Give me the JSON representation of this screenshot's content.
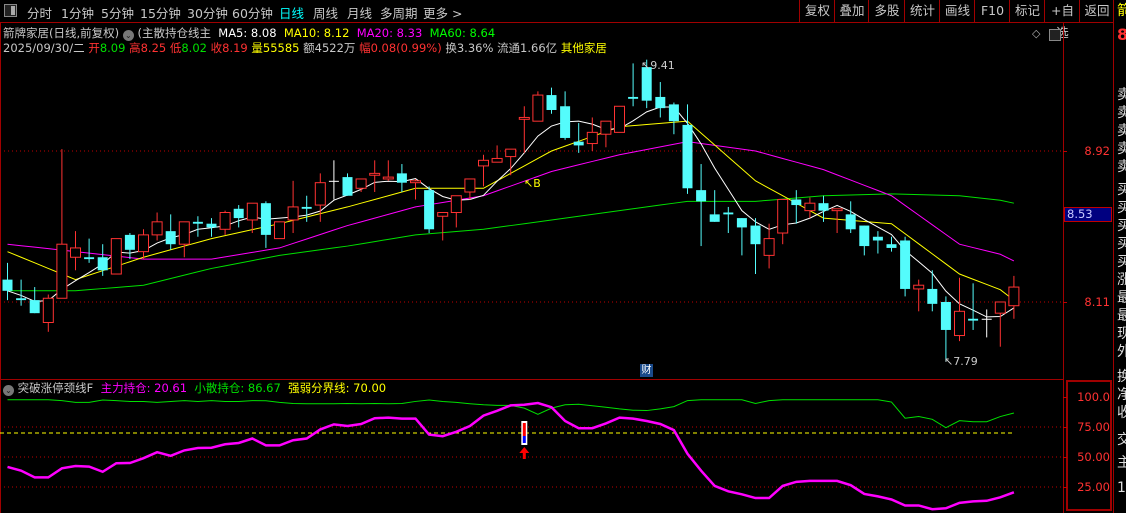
{
  "toolbar": {
    "periods": [
      "分时",
      "1分钟",
      "5分钟",
      "15分钟",
      "30分钟",
      "60分钟",
      "日线",
      "周线",
      "月线",
      "多周期",
      "更多 >"
    ],
    "active_period": "日线",
    "right_buttons": [
      "复权",
      "叠加",
      "多股",
      "统计",
      "画线",
      "F10",
      "标记",
      "+自选",
      "返回"
    ]
  },
  "info": {
    "title": "箭牌家居(日线,前复权)",
    "indicator_name": "(主散持仓线主",
    "ma5": "MA5: 8.08",
    "ma10": "MA10: 8.12",
    "ma20": "MA20: 8.33",
    "ma60": "MA60: 8.64",
    "date": "2025/09/30/二",
    "open_label": "开",
    "open": "8.09",
    "high_label": "高",
    "high": "8.25",
    "low_label": "低",
    "low": "8.02",
    "close_label": "收",
    "close": "8.19",
    "vol_label": "量",
    "vol": "55585",
    "amount": "额4522万",
    "change_label": "幅",
    "change": "0.08(0.99%)",
    "turnover": "换3.36%",
    "float": "流通1.66亿",
    "sector": "其他家居"
  },
  "colors": {
    "up": "#ff3232",
    "down": "#54fcfc",
    "ma5": "#ffffff",
    "ma10": "#ffff00",
    "ma20": "#ff00ff",
    "ma60": "#00e000",
    "grid": "#c00000",
    "main_force": "#ff00ff",
    "retail": "#00e000",
    "threshold": "#ffff00"
  },
  "price_axis": {
    "labels": [
      "8.92",
      "8.11"
    ],
    "current": "8.53"
  },
  "annotations": {
    "high": "9.41",
    "low": "7.79",
    "buy_marker": "B",
    "finance_badge": "财"
  },
  "indicator": {
    "name": "突破涨停颈线F",
    "main_force": "主力持仓: 20.61",
    "retail": "小散持仓: 86.67",
    "threshold": "强弱分界线: 70.00",
    "axis_labels": [
      "100.0",
      "75.00",
      "50.00",
      "25.00"
    ]
  },
  "right_strip": {
    "top": "箭",
    "price": "8",
    "chars": [
      "卖",
      "卖",
      "卖",
      "卖",
      "卖",
      "买",
      "买",
      "买",
      "买",
      "买",
      "涨",
      "最",
      "最",
      "现",
      "外",
      "换",
      "净",
      "收",
      "交",
      "主",
      "1"
    ]
  },
  "chart_data": [
    {
      "type": "candlestick",
      "ohlc_fields": [
        "open",
        "high",
        "low",
        "close"
      ],
      "ylim": [
        7.7,
        9.45
      ],
      "grid_lines": [
        8.92,
        8.11
      ],
      "candles": [
        [
          8.23,
          8.32,
          8.12,
          8.17
        ],
        [
          8.13,
          8.23,
          8.09,
          8.12
        ],
        [
          8.12,
          8.19,
          8.05,
          8.05
        ],
        [
          8.0,
          8.15,
          7.95,
          8.13
        ],
        [
          8.13,
          8.93,
          8.13,
          8.42
        ],
        [
          8.35,
          8.49,
          8.28,
          8.4
        ],
        [
          8.35,
          8.45,
          8.32,
          8.34
        ],
        [
          8.35,
          8.42,
          8.25,
          8.28
        ],
        [
          8.26,
          8.45,
          8.26,
          8.45
        ],
        [
          8.47,
          8.48,
          8.34,
          8.39
        ],
        [
          8.38,
          8.5,
          8.34,
          8.47
        ],
        [
          8.47,
          8.59,
          8.44,
          8.54
        ],
        [
          8.49,
          8.58,
          8.39,
          8.42
        ],
        [
          8.42,
          8.54,
          8.35,
          8.54
        ],
        [
          8.54,
          8.57,
          8.46,
          8.53
        ],
        [
          8.53,
          8.56,
          8.46,
          8.51
        ],
        [
          8.5,
          8.6,
          8.47,
          8.59
        ],
        [
          8.61,
          8.63,
          8.51,
          8.56
        ],
        [
          8.55,
          8.64,
          8.48,
          8.64
        ],
        [
          8.64,
          8.65,
          8.4,
          8.47
        ],
        [
          8.45,
          8.54,
          8.45,
          8.54
        ],
        [
          8.55,
          8.76,
          8.48,
          8.62
        ],
        [
          8.62,
          8.68,
          8.54,
          8.61
        ],
        [
          8.63,
          8.8,
          8.54,
          8.75
        ],
        [
          8.76,
          8.87,
          8.66,
          8.76
        ],
        [
          8.78,
          8.8,
          8.68,
          8.68
        ],
        [
          8.72,
          8.77,
          8.7,
          8.77
        ],
        [
          8.79,
          8.87,
          8.7,
          8.8
        ],
        [
          8.77,
          8.87,
          8.76,
          8.78
        ],
        [
          8.8,
          8.85,
          8.7,
          8.75
        ],
        [
          8.75,
          8.77,
          8.66,
          8.76
        ],
        [
          8.71,
          8.73,
          8.48,
          8.5
        ],
        [
          8.57,
          8.59,
          8.44,
          8.59
        ],
        [
          8.59,
          8.68,
          8.51,
          8.68
        ],
        [
          8.7,
          8.77,
          8.66,
          8.77
        ],
        [
          8.84,
          8.9,
          8.73,
          8.87
        ],
        [
          8.86,
          8.95,
          8.86,
          8.88
        ],
        [
          8.89,
          8.93,
          8.79,
          8.93
        ],
        [
          9.09,
          9.16,
          8.91,
          9.1
        ],
        [
          9.08,
          9.24,
          9.08,
          9.22
        ],
        [
          9.22,
          9.26,
          9.12,
          9.14
        ],
        [
          9.16,
          9.24,
          8.98,
          8.99
        ],
        [
          8.97,
          9.07,
          8.91,
          8.95
        ],
        [
          8.96,
          9.1,
          8.92,
          9.02
        ],
        [
          9.01,
          9.08,
          8.94,
          9.08
        ],
        [
          9.02,
          9.16,
          9.02,
          9.16
        ],
        [
          9.21,
          9.39,
          9.16,
          9.2
        ],
        [
          9.37,
          9.41,
          9.15,
          9.19
        ],
        [
          9.21,
          9.29,
          9.1,
          9.15
        ],
        [
          9.17,
          9.18,
          9.01,
          9.08
        ],
        [
          9.06,
          9.17,
          8.69,
          8.72
        ],
        [
          8.71,
          8.85,
          8.41,
          8.65
        ],
        [
          8.58,
          8.71,
          8.54,
          8.54
        ],
        [
          8.59,
          8.62,
          8.48,
          8.58
        ],
        [
          8.56,
          8.56,
          8.36,
          8.51
        ],
        [
          8.52,
          8.56,
          8.26,
          8.42
        ],
        [
          8.36,
          8.53,
          8.29,
          8.45
        ],
        [
          8.48,
          8.66,
          8.42,
          8.66
        ],
        [
          8.66,
          8.71,
          8.53,
          8.63
        ],
        [
          8.6,
          8.67,
          8.56,
          8.64
        ],
        [
          8.64,
          8.68,
          8.54,
          8.6
        ],
        [
          8.6,
          8.61,
          8.48,
          8.61
        ],
        [
          8.58,
          8.65,
          8.48,
          8.5
        ],
        [
          8.52,
          8.52,
          8.36,
          8.41
        ],
        [
          8.46,
          8.49,
          8.37,
          8.44
        ],
        [
          8.42,
          8.46,
          8.38,
          8.4
        ],
        [
          8.44,
          8.46,
          8.14,
          8.18
        ],
        [
          8.18,
          8.23,
          8.06,
          8.2
        ],
        [
          8.18,
          8.28,
          8.06,
          8.1
        ],
        [
          8.11,
          8.14,
          7.79,
          7.96
        ],
        [
          7.93,
          8.24,
          7.9,
          8.06
        ],
        [
          8.02,
          8.21,
          7.96,
          8.01
        ],
        [
          8.02,
          8.07,
          7.92,
          8.02
        ],
        [
          8.05,
          8.11,
          7.87,
          8.11
        ],
        [
          8.09,
          8.25,
          8.02,
          8.19
        ]
      ],
      "ma_sample_every": 5,
      "ma10": [
        8.38,
        8.23,
        8.35,
        8.45,
        8.53,
        8.62,
        8.72,
        8.72,
        8.92,
        9.05,
        9.08,
        8.76,
        8.56,
        8.53,
        8.26,
        8.12
      ],
      "ma20": [
        8.42,
        8.38,
        8.34,
        8.34,
        8.4,
        8.52,
        8.62,
        8.68,
        8.81,
        8.9,
        8.97,
        8.92,
        8.82,
        8.68,
        8.42,
        8.33
      ],
      "ma60": [
        8.17,
        8.17,
        8.2,
        8.29,
        8.36,
        8.41,
        8.47,
        8.5,
        8.55,
        8.6,
        8.65,
        8.65,
        8.68,
        8.69,
        8.68,
        8.64
      ]
    },
    {
      "type": "line",
      "ylim": [
        0,
        110
      ],
      "grid_lines": [
        75,
        50,
        25
      ],
      "threshold": 70,
      "signal_index": 38,
      "series": [
        {
          "name": "主力持仓",
          "values": [
            41.7,
            38.6,
            33,
            33,
            40.6,
            42.5,
            42,
            37.7,
            44.8,
            45,
            49,
            54,
            51,
            55.5,
            57.5,
            57.7,
            60.6,
            61.7,
            65.4,
            59.7,
            59.7,
            64,
            65.4,
            73,
            77.2,
            75.8,
            77.5,
            82.3,
            82.8,
            82,
            82,
            68.7,
            67.3,
            71,
            75.8,
            84.5,
            88.5,
            93,
            93.5,
            95,
            91.5,
            80,
            74,
            74,
            78,
            82.8,
            82,
            80,
            77.5,
            72.4,
            52.7,
            38.6,
            25.9,
            21.4,
            18.9,
            15.8,
            15.8,
            25.9,
            29.3,
            30.1,
            30.1,
            30.1,
            26.5,
            19.2,
            17.2,
            14.6,
            9.6,
            9.6,
            6.5,
            7.3,
            11.8,
            13,
            13.5,
            16.4,
            20.61
          ]
        },
        {
          "name": "小散持仓",
          "values": [
            97.7,
            97.7,
            97.7,
            97.7,
            97,
            95.5,
            95.5,
            97.5,
            97,
            96.3,
            96.3,
            95.5,
            96.3,
            97,
            96.3,
            97,
            96.3,
            96.3,
            97,
            96.9,
            95.5,
            94.6,
            94.4,
            94.4,
            94.4,
            94.6,
            94.4,
            94.6,
            94.4,
            94.6,
            96.3,
            97.5,
            96.3,
            95.5,
            94.4,
            93.5,
            93,
            93,
            90.7,
            85.6,
            90.7,
            93.5,
            94,
            92.7,
            91.5,
            90.1,
            89,
            88.7,
            90.1,
            92,
            97,
            97.7,
            97.7,
            97.7,
            97.7,
            94.6,
            97,
            97.7,
            97.7,
            97.7,
            97.7,
            97.7,
            97.7,
            97.7,
            97.7,
            95.8,
            82.3,
            83.7,
            81.4,
            74.4,
            80.3,
            79.4,
            79.4,
            83.7,
            86.67
          ]
        }
      ]
    }
  ]
}
